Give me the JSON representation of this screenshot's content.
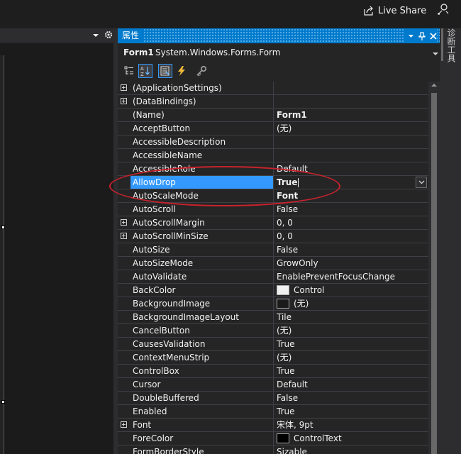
{
  "topbar": {
    "live_share_label": "Live Share",
    "live_share_icon": "share-icon",
    "feedback_icon": "feedback-icon"
  },
  "panel": {
    "title": "属性",
    "title_buttons": [
      "dropdown-icon",
      "pin-icon",
      "close-icon"
    ],
    "object_name": "Form1",
    "object_type": "System.Windows.Forms.Form",
    "toolbar": [
      "categorized-icon",
      "alphabetical-icon",
      "properties-icon",
      "events-icon",
      "property-pages-icon"
    ]
  },
  "right_sidebar": {
    "tab_label": "诊断工具"
  },
  "properties": [
    {
      "name": "(ApplicationSettings)",
      "value": "",
      "expandable": true
    },
    {
      "name": "(DataBindings)",
      "value": "",
      "expandable": true
    },
    {
      "name": "(Name)",
      "value": "Form1",
      "bold": true
    },
    {
      "name": "AcceptButton",
      "value": "(无)"
    },
    {
      "name": "AccessibleDescription",
      "value": ""
    },
    {
      "name": "AccessibleName",
      "value": ""
    },
    {
      "name": "AccessibleRole",
      "value": "Default"
    },
    {
      "name": "AllowDrop",
      "value": "True",
      "bold": true,
      "selected": true
    },
    {
      "name": "AutoScaleMode",
      "value": "Font",
      "bold": true
    },
    {
      "name": "AutoScroll",
      "value": "False"
    },
    {
      "name": "AutoScrollMargin",
      "value": "0, 0",
      "expandable": true
    },
    {
      "name": "AutoScrollMinSize",
      "value": "0, 0",
      "expandable": true
    },
    {
      "name": "AutoSize",
      "value": "False"
    },
    {
      "name": "AutoSizeMode",
      "value": "GrowOnly"
    },
    {
      "name": "AutoValidate",
      "value": "EnablePreventFocusChange"
    },
    {
      "name": "BackColor",
      "value": "Control",
      "swatch": "#f0f0f0"
    },
    {
      "name": "BackgroundImage",
      "value": "(无)",
      "swatch": "#1b1b1b"
    },
    {
      "name": "BackgroundImageLayout",
      "value": "Tile"
    },
    {
      "name": "CancelButton",
      "value": "(无)"
    },
    {
      "name": "CausesValidation",
      "value": "True"
    },
    {
      "name": "ContextMenuStrip",
      "value": "(无)"
    },
    {
      "name": "ControlBox",
      "value": "True"
    },
    {
      "name": "Cursor",
      "value": "Default"
    },
    {
      "name": "DoubleBuffered",
      "value": "False"
    },
    {
      "name": "Enabled",
      "value": "True"
    },
    {
      "name": "Font",
      "value": "宋体, 9pt",
      "expandable": true
    },
    {
      "name": "ForeColor",
      "value": "ControlText",
      "swatch": "#000000"
    },
    {
      "name": "FormBorderStyle",
      "value": "Sizable"
    }
  ],
  "colors": {
    "accent": "#007acc",
    "selection": "#3399ff",
    "annotation": "#c8232c"
  }
}
